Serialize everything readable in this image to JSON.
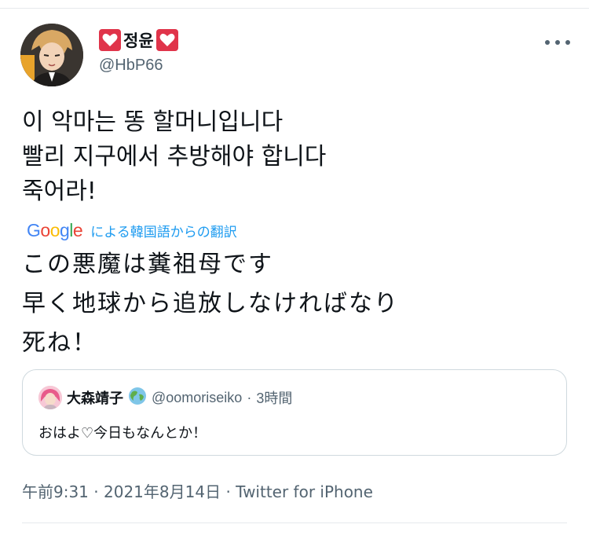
{
  "author": {
    "display_name": "정윤",
    "handle": "@HbP66",
    "avatar_icon": "anime-character-avatar",
    "badge_icon": "heart-emoji"
  },
  "tweet": {
    "lines": [
      "이 악마는 똥 할머니입니다",
      "빨리 지구에서 추방해야 합니다",
      "죽어라!"
    ]
  },
  "translation": {
    "logo_text": "Google",
    "label": "による韓国語からの翻訳",
    "lines": [
      "この悪魔は糞祖母です",
      "早く地球から追放しなければなり",
      "死ね！"
    ]
  },
  "quote": {
    "name": "大森靖子",
    "name_emoji": "globe-emoji",
    "handle": "@oomoriseiko",
    "separator": "·",
    "time": "3時間",
    "text": "おはよ♡今日もなんとか！"
  },
  "meta": {
    "time": "午前9:31",
    "date": "2021年8月14日",
    "source": "Twitter for iPhone",
    "separator": "·"
  },
  "colors": {
    "link": "#1d9bf0",
    "secondary_text": "#536471",
    "heart": "#e0344a"
  }
}
